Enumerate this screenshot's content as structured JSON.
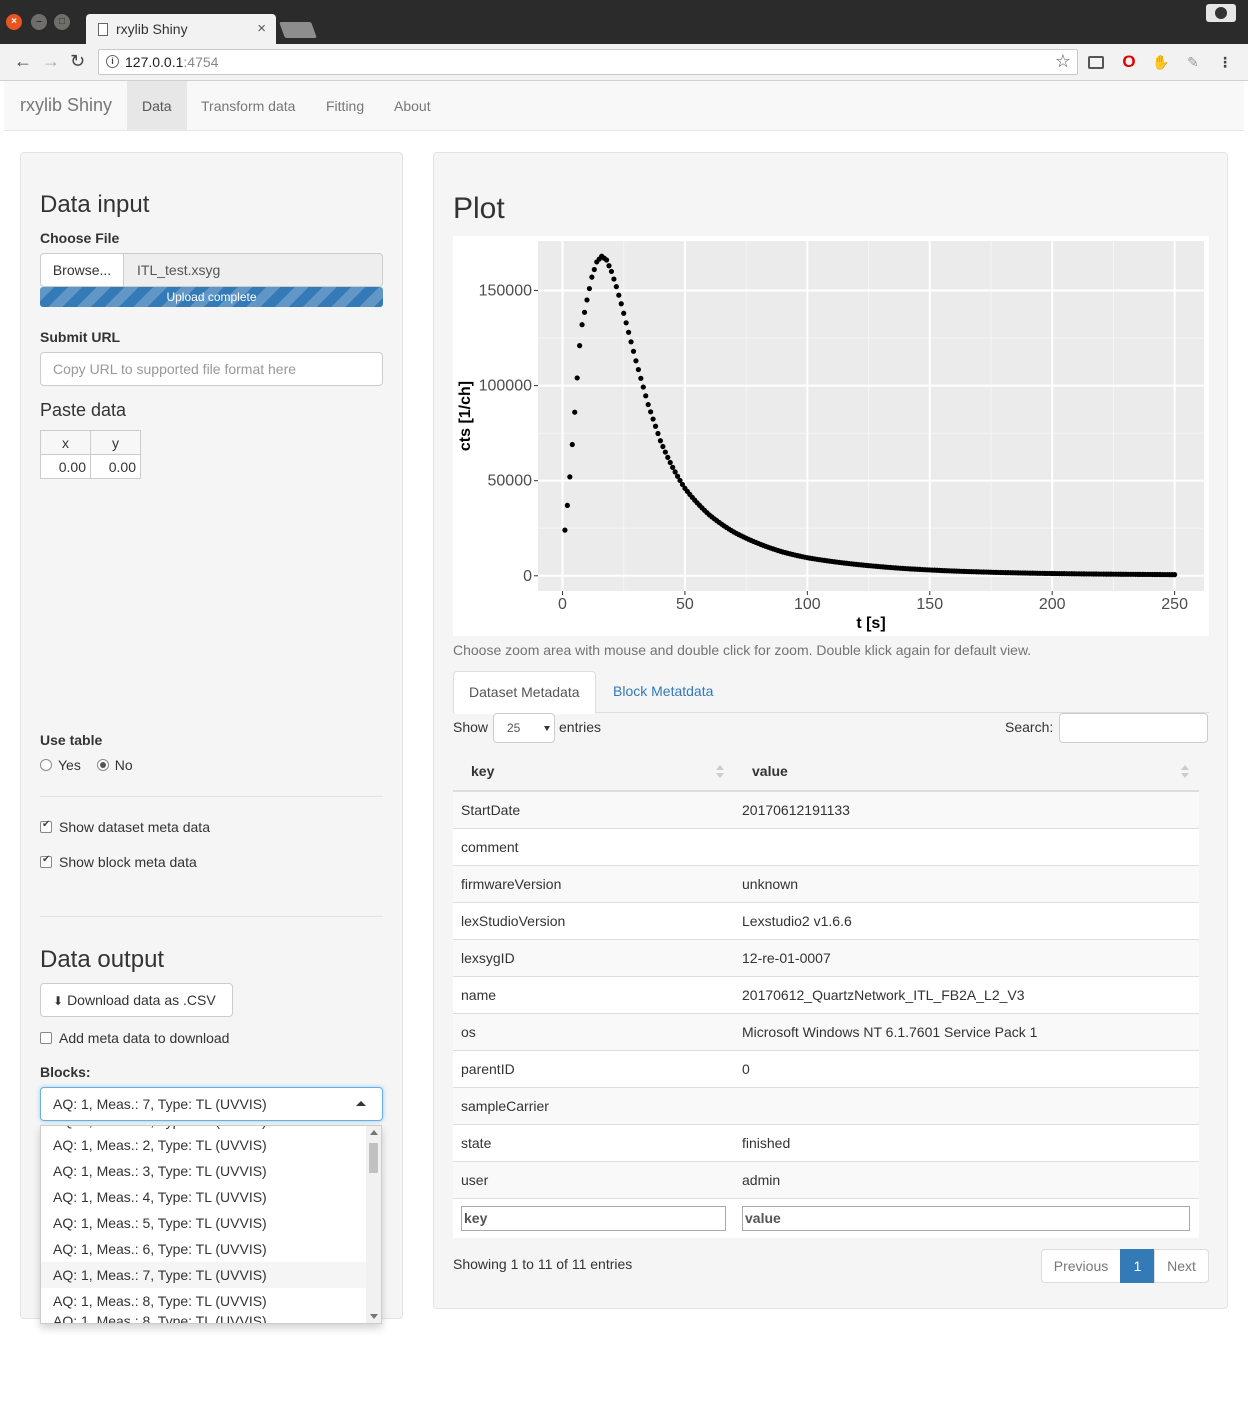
{
  "browser": {
    "tab_title": "rxylib Shiny",
    "url_host": "127.0.0.1",
    "url_port": ":4754"
  },
  "navbar": {
    "brand": "rxylib Shiny",
    "tabs": [
      "Data",
      "Transform data",
      "Fitting",
      "About"
    ],
    "active_tab": "Data"
  },
  "sidebar": {
    "data_input_title": "Data input",
    "choose_file_label": "Choose File",
    "browse_label": "Browse...",
    "file_name": "ITL_test.xsyg",
    "upload_status": "Upload complete",
    "upload_progress": 1.0,
    "submit_url_label": "Submit URL",
    "submit_url_placeholder": "Copy URL to supported file format here",
    "paste_data_title": "Paste data",
    "paste_headers": [
      "x",
      "y"
    ],
    "paste_values": [
      "0.00",
      "0.00"
    ],
    "use_table_label": "Use table",
    "use_table_options": [
      "Yes",
      "No"
    ],
    "use_table_selected": "No",
    "show_dataset_meta": "Show dataset meta data",
    "show_block_meta": "Show block meta data",
    "data_output_title": "Data output",
    "download_label": "Download data as .CSV",
    "add_meta_label": "Add meta data to download",
    "blocks_label": "Blocks:",
    "blocks_selected": "AQ: 1, Meas.: 7, Type: TL (UVVIS)",
    "blocks_options": [
      "AQ: 1, Meas.: 2, Type: TL (UVVIS)",
      "AQ: 1, Meas.: 3, Type: TL (UVVIS)",
      "AQ: 1, Meas.: 4, Type: TL (UVVIS)",
      "AQ: 1, Meas.: 5, Type: TL (UVVIS)",
      "AQ: 1, Meas.: 6, Type: TL (UVVIS)",
      "AQ: 1, Meas.: 7, Type: TL (UVVIS)",
      "AQ: 1, Meas.: 8, Type: TL (UVVIS)"
    ]
  },
  "main": {
    "plot_title": "Plot",
    "plot_note": "Choose zoom area with mouse and double click for zoom. Double klick again for default view.",
    "meta_tabs": [
      "Dataset Metadata",
      "Block Metatdata"
    ],
    "show_label": "Show",
    "page_length": "25",
    "entries_label": "entries",
    "search_label": "Search:",
    "table_headers": [
      "key",
      "value"
    ],
    "rows": [
      [
        "StartDate",
        "20170612191133"
      ],
      [
        "comment",
        ""
      ],
      [
        "firmwareVersion",
        "unknown"
      ],
      [
        "lexStudioVersion",
        "Lexstudio2 v1.6.6"
      ],
      [
        "lexsygID",
        "12-re-01-0007"
      ],
      [
        "name",
        "20170612_QuartzNetwork_ITL_FB2A_L2_V3"
      ],
      [
        "os",
        "Microsoft Windows NT 6.1.7601 Service Pack 1"
      ],
      [
        "parentID",
        "0"
      ],
      [
        "sampleCarrier",
        ""
      ],
      [
        "state",
        "finished"
      ],
      [
        "user",
        "admin"
      ]
    ],
    "filter_placeholders": [
      "key",
      "value"
    ],
    "info": "Showing 1 to 11 of 11 entries",
    "pager": {
      "prev": "Previous",
      "current": "1",
      "next": "Next"
    }
  },
  "chart_data": {
    "type": "scatter",
    "xlabel": "t [s]",
    "ylabel": "cts [1/ch]",
    "xlim": [
      -10,
      262
    ],
    "ylim": [
      -8000,
      176000
    ],
    "x_ticks": [
      0,
      50,
      100,
      150,
      200,
      250
    ],
    "y_ticks": [
      0,
      50000,
      100000,
      150000
    ],
    "y_tick_labels": [
      "0",
      "50000",
      "100000",
      "150000"
    ],
    "grid": true,
    "point_color": "#000000",
    "panel_color": "#ebebeb",
    "key_points": [
      {
        "x": 1,
        "y": 24000
      },
      {
        "x": 2,
        "y": 37000
      },
      {
        "x": 3,
        "y": 52000
      },
      {
        "x": 4,
        "y": 69000
      },
      {
        "x": 5,
        "y": 86000
      },
      {
        "x": 6,
        "y": 104000
      },
      {
        "x": 7,
        "y": 121000
      },
      {
        "x": 8,
        "y": 132000
      },
      {
        "x": 10,
        "y": 145000
      },
      {
        "x": 12,
        "y": 157000
      },
      {
        "x": 14,
        "y": 165000
      },
      {
        "x": 16,
        "y": 168000
      },
      {
        "x": 18,
        "y": 166000
      },
      {
        "x": 20,
        "y": 160000
      },
      {
        "x": 22,
        "y": 152000
      },
      {
        "x": 24,
        "y": 143000
      },
      {
        "x": 27,
        "y": 128000
      },
      {
        "x": 30,
        "y": 113000
      },
      {
        "x": 35,
        "y": 90000
      },
      {
        "x": 40,
        "y": 71000
      },
      {
        "x": 45,
        "y": 57000
      },
      {
        "x": 50,
        "y": 46000
      },
      {
        "x": 60,
        "y": 32000
      },
      {
        "x": 70,
        "y": 23000
      },
      {
        "x": 80,
        "y": 17000
      },
      {
        "x": 90,
        "y": 12500
      },
      {
        "x": 100,
        "y": 9500
      },
      {
        "x": 120,
        "y": 6000
      },
      {
        "x": 140,
        "y": 3800
      },
      {
        "x": 160,
        "y": 2500
      },
      {
        "x": 180,
        "y": 1700
      },
      {
        "x": 200,
        "y": 1200
      },
      {
        "x": 220,
        "y": 900
      },
      {
        "x": 240,
        "y": 700
      },
      {
        "x": 250,
        "y": 600
      }
    ]
  }
}
